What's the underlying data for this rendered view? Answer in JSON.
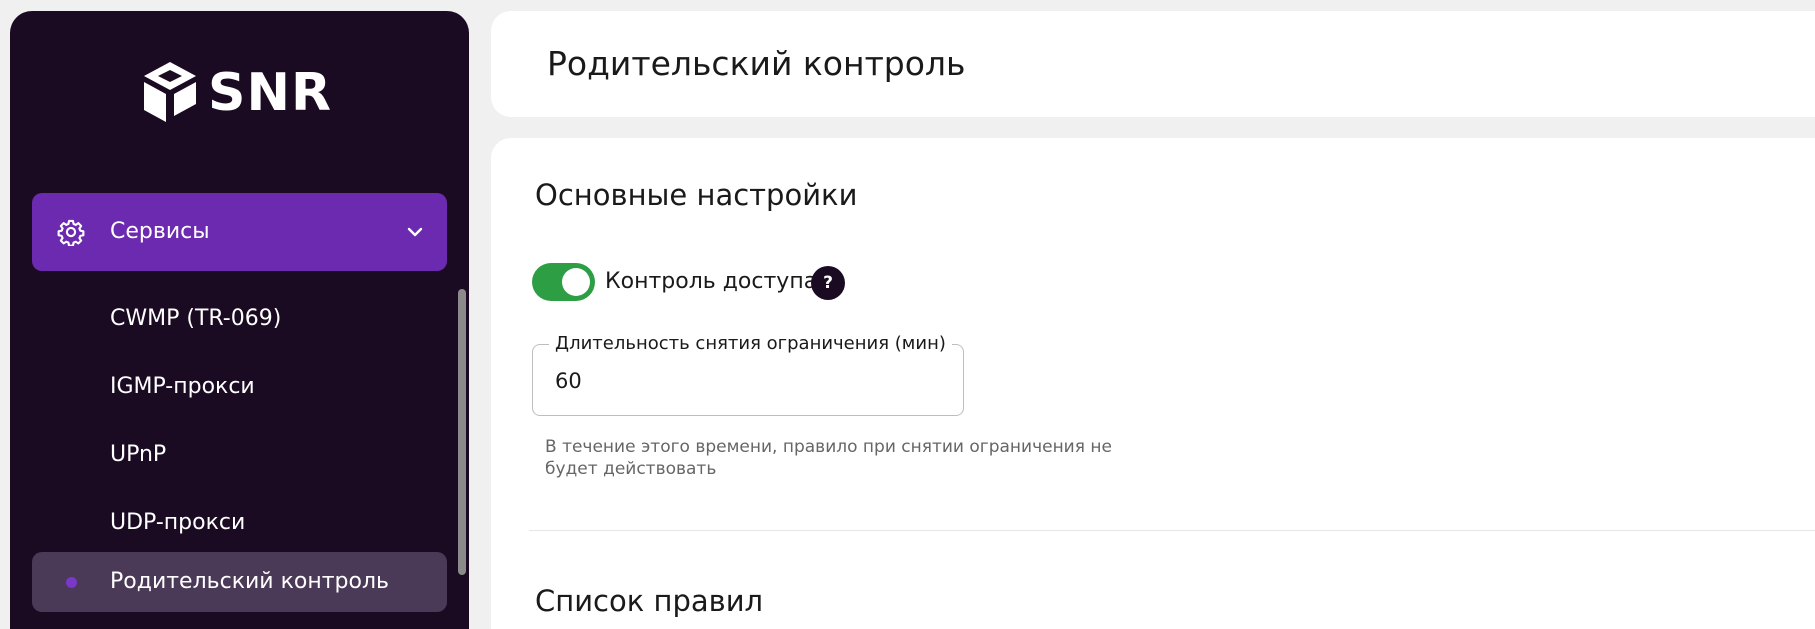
{
  "brand": {
    "name": "SNR"
  },
  "sidebar": {
    "group": {
      "label": "Сервисы",
      "icon": "gear-icon",
      "expanded": true
    },
    "items": [
      {
        "label": "CWMP (TR-069)",
        "active": false
      },
      {
        "label": "IGMP-прокси",
        "active": false
      },
      {
        "label": "UPnP",
        "active": false
      },
      {
        "label": "UDP-прокси",
        "active": false
      },
      {
        "label": "Родительский контроль",
        "active": true
      }
    ]
  },
  "header": {
    "title": "Родительский контроль"
  },
  "main": {
    "basic_settings": {
      "title": "Основные настройки",
      "access_control": {
        "label": "Контроль доступа",
        "enabled": true,
        "help_glyph": "?"
      },
      "duration": {
        "label": "Длительность снятия ограничения (мин)",
        "value": "60",
        "hint": "В течение этого времени, правило при снятии ограничения не будет действовать"
      }
    },
    "rules": {
      "title": "Список правил"
    }
  },
  "colors": {
    "sidebar_bg": "#1a0b23",
    "accent": "#6c2ab0",
    "active_item_bg": "#4b3a57",
    "toggle_on": "#2e9e44"
  }
}
